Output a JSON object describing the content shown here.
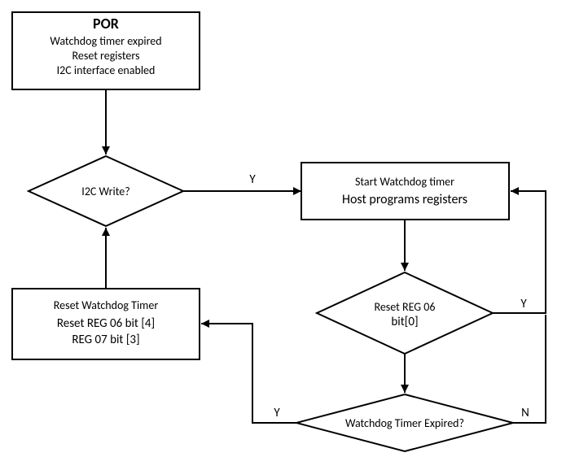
{
  "por": {
    "title": "POR",
    "line1": "Watchdog timer expired",
    "line2": "Reset registers",
    "line3": "I2C interface enabled"
  },
  "decision_i2c": {
    "text": "I2C Write?",
    "yes": "Y"
  },
  "start_wd": {
    "line1": "Start Watchdog timer",
    "line2": "Host programs registers"
  },
  "decision_reset06": {
    "line1": "Reset REG 06",
    "line2": "bit[0]",
    "yes": "Y"
  },
  "reset_wd": {
    "line1": "Reset Watchdog Timer",
    "line2": "Reset REG 06 bit [4]",
    "line3": "REG 07 bit [3]"
  },
  "decision_expired": {
    "text": "Watchdog Timer Expired?",
    "yes": "Y",
    "no": "N"
  }
}
